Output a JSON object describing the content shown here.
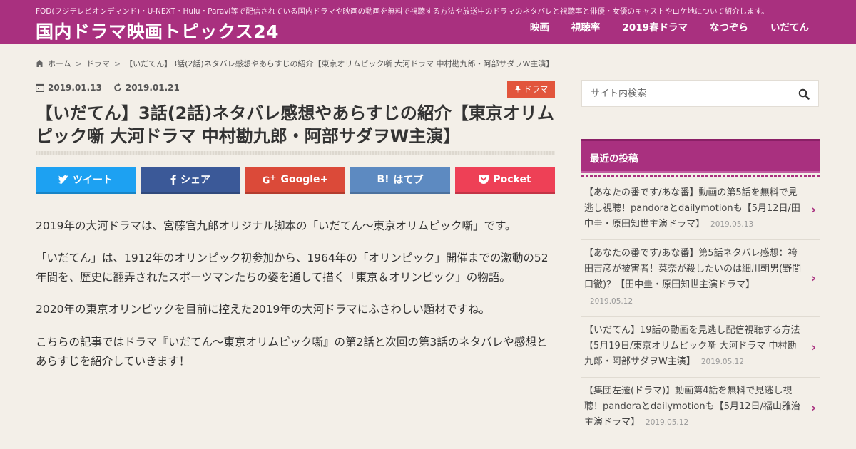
{
  "header": {
    "tagline": "FOD(フジテレビオンデマンド)・U-NEXT・Hulu・Paravi等で配信されている国内ドラマや映画の動画を無料で視聴する方法や放送中のドラマのネタバレと視聴率と俳優・女優のキャストやロケ地について紹介します。",
    "site_title": "国内ドラマ映画トピックス24",
    "nav": [
      "映画",
      "視聴率",
      "2019春ドラマ",
      "なつぞら",
      "いだてん"
    ]
  },
  "breadcrumb": {
    "home": "ホーム",
    "category": "ドラマ",
    "current": "【いだてん】3話(2話)ネタバレ感想やあらすじの紹介【東京オリムピック噺 大河ドラマ 中村勘九郎・阿部サダヲW主演】"
  },
  "article": {
    "published": "2019.01.13",
    "updated": "2019.01.21",
    "category": "ドラマ",
    "title": "【いだてん】3話(2話)ネタバレ感想やあらすじの紹介【東京オリムピック噺 大河ドラマ 中村勘九郎・阿部サダヲW主演】",
    "share": {
      "twitter": "ツイート",
      "facebook": "シェア",
      "google": "Google+",
      "hatena": "はてブ",
      "pocket": "Pocket"
    },
    "paragraphs": [
      "2019年の大河ドラマは、宮藤官九郎オリジナル脚本の「いだてん～東京オリムピック噺」です。",
      "「いだてん」は、1912年のオリンピック初参加から、1964年の「オリンピック」開催までの激動の52年間を、歴史に翻弄されたスポーツマンたちの姿を通して描く「東京＆オリンピック」の物語。",
      "2020年の東京オリンピックを目前に控えた2019年の大河ドラマにふさわしい題材ですね。",
      "こちらの記事ではドラマ『いだてん～東京オリムピック噺』の第2話と次回の第3話のネタバレや感想とあらすじを紹介していきます！"
    ]
  },
  "sidebar": {
    "search_placeholder": "サイト内検索",
    "recent_title": "最近の投稿",
    "posts": [
      {
        "title": "【あなたの番です/あな番】動画の第5話を無料で見逃し視聴！pandoraとdailymotionも【5月12日/田中圭・原田知世主演ドラマ】",
        "date": "2019.05.13"
      },
      {
        "title": "【あなたの番です/あな番】第5話ネタバレ感想：袴田吉彦が被害者！菜奈が殺したいのは細川朝男(野間口徹)？【田中圭・原田知世主演ドラマ】",
        "date": "2019.05.12"
      },
      {
        "title": "【いだてん】19話の動画を見逃し配信視聴する方法【5月19日/東京オリムピック噺 大河ドラマ 中村勘九郎・阿部サダヲW主演】",
        "date": "2019.05.12"
      },
      {
        "title": "【集団左遷(ドラマ)】動画第4話を無料で見逃し視聴！pandoraとdailymotionも【5月12日/福山雅治主演ドラマ】",
        "date": "2019.05.12"
      }
    ]
  },
  "colors": {
    "brand": "#a9307f",
    "category_badge": "#e2553c",
    "twitter": "#1da1f2",
    "facebook": "#3b5998",
    "google": "#db4a39",
    "hatena": "#5d8ac1",
    "pocket": "#ee4056"
  }
}
